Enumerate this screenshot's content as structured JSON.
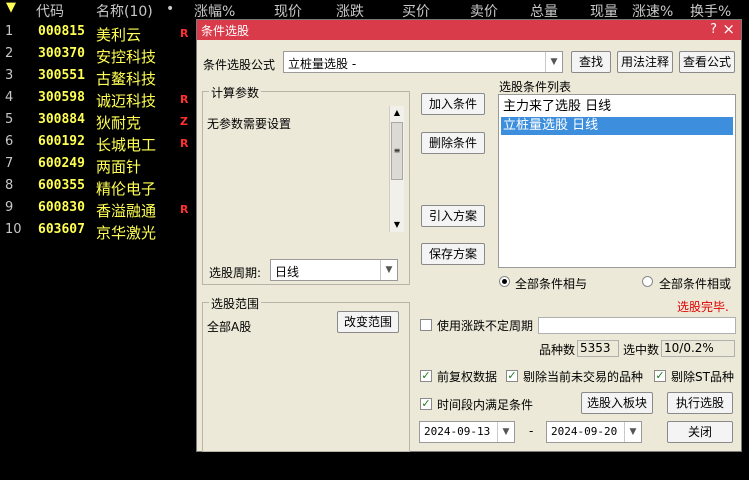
{
  "header": {
    "row_number_icon": "triangle-down-icon",
    "columns": [
      "代码",
      "名称(10)",
      "•",
      "涨幅%",
      "现价",
      "涨跌",
      "买价",
      "卖价",
      "总量",
      "现量",
      "涨速%",
      "换手%"
    ]
  },
  "stocks": [
    {
      "n": "1",
      "code": "000815",
      "name": "美利云",
      "flag": "R"
    },
    {
      "n": "2",
      "code": "300370",
      "name": "安控科技",
      "flag": ""
    },
    {
      "n": "3",
      "code": "300551",
      "name": "古鳌科技",
      "flag": ""
    },
    {
      "n": "4",
      "code": "300598",
      "name": "诚迈科技",
      "flag": "R"
    },
    {
      "n": "5",
      "code": "300884",
      "name": "狄耐克",
      "flag": "Z"
    },
    {
      "n": "6",
      "code": "600192",
      "name": "长城电工",
      "flag": "R"
    },
    {
      "n": "7",
      "code": "600249",
      "name": "两面针",
      "flag": ""
    },
    {
      "n": "8",
      "code": "600355",
      "name": "精伦电子",
      "flag": ""
    },
    {
      "n": "9",
      "code": "600830",
      "name": "香溢融通",
      "flag": "R"
    },
    {
      "n": "10",
      "code": "603607",
      "name": "京华激光",
      "flag": ""
    }
  ],
  "colors": {
    "title_bar": "#d93b4a",
    "code": "#ffff54",
    "flag": "#ff3030",
    "selection": "#3d8fde",
    "status": "#e00000"
  },
  "dialog": {
    "title": "条件选股",
    "title_buttons": {
      "help": "?",
      "close": "×"
    },
    "formula_label": "条件选股公式",
    "formula_value": "立桩量选股   -",
    "btn_find": "查找",
    "btn_usage": "用法注释",
    "btn_view": "查看公式",
    "calc_group": "计算参数",
    "calc_text": "无参数需要设置",
    "period_label": "选股周期:",
    "period_value": "日线",
    "btn_add": "加入条件",
    "btn_delete": "删除条件",
    "btn_import": "引入方案",
    "btn_save": "保存方案",
    "cond_list_label": "选股条件列表",
    "cond_list": [
      {
        "text": "主力来了选股  日线",
        "selected": false
      },
      {
        "text": "立桩量选股  日线",
        "selected": true
      }
    ],
    "radio_and": "全部条件相与",
    "radio_or": "全部条件相或",
    "status": "选股完毕.",
    "range_group": "选股范围",
    "range_value": "全部A股",
    "btn_change_range": "改变范围",
    "chk_period": "使用涨跌不定周期",
    "count_label": "品种数",
    "count_value": "5353",
    "selected_label": "选中数",
    "selected_value": "10/0.2%",
    "chk_fq": "前复权数据",
    "chk_exclude_untraded": "剔除当前未交易的品种",
    "chk_exclude_st": "剔除ST品种",
    "chk_timerange": "时间段内满足条件",
    "btn_to_board": "选股入板块",
    "btn_execute": "执行选股",
    "date_from": "2024-09-13",
    "date_sep": "-",
    "date_to": "2024-09-20",
    "btn_close": "关闭"
  }
}
